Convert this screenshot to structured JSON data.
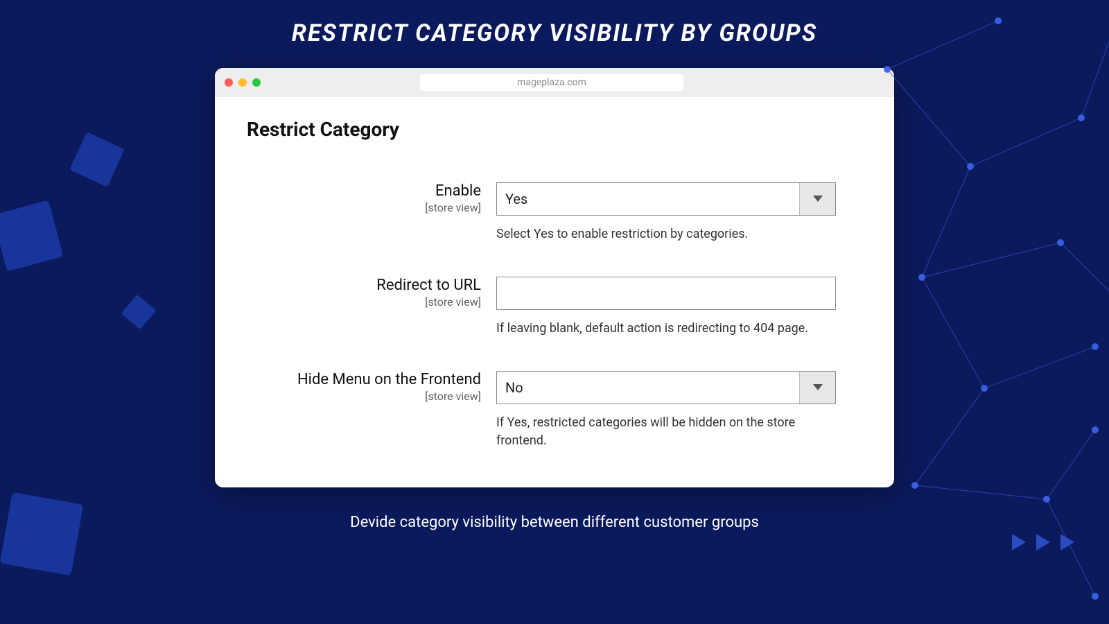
{
  "header": {
    "title": "RESTRICT CATEGORY VISIBILITY BY GROUPS",
    "subtitle": "Devide category visibility between different customer groups"
  },
  "browser": {
    "url": "mageplaza.com"
  },
  "section": {
    "title": "Restrict Category"
  },
  "fields": {
    "enable": {
      "label": "Enable",
      "scope": "[store view]",
      "value": "Yes",
      "help": "Select Yes to enable restriction by categories."
    },
    "redirect": {
      "label": "Redirect to URL",
      "scope": "[store view]",
      "value": "",
      "help": "If leaving blank, default action is redirecting to 404 page."
    },
    "hidemenu": {
      "label": "Hide Menu on the Frontend",
      "scope": "[store view]",
      "value": "No",
      "help": "If Yes, restricted categories will be hidden on the store frontend."
    }
  },
  "colors": {
    "bg": "#0b1a5c",
    "accent": "#2f52c9"
  }
}
